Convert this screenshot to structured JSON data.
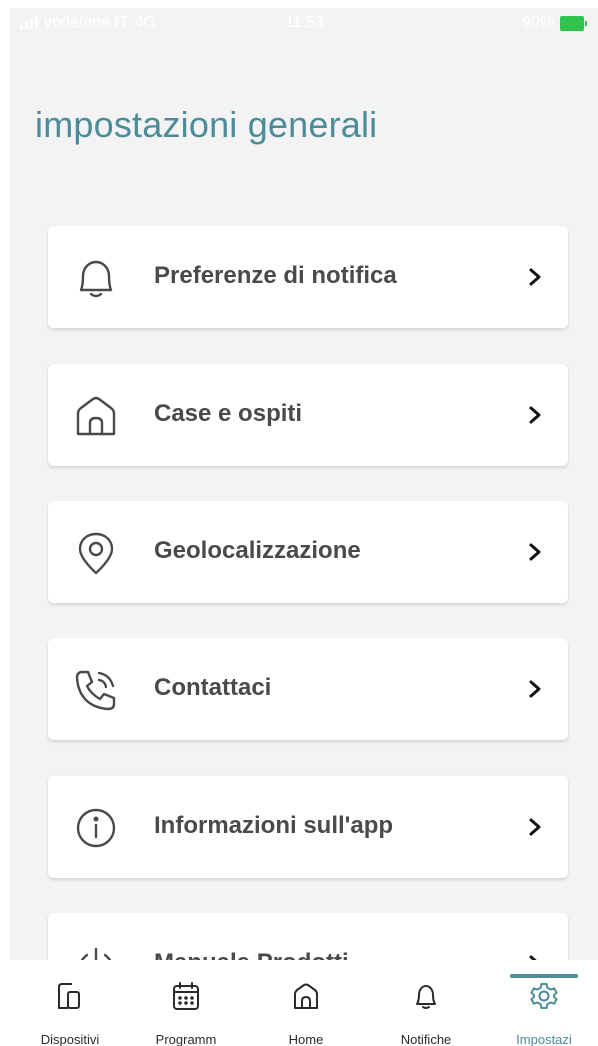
{
  "status_bar": {
    "carrier": "vodafone IT",
    "network": "4G",
    "time": "11:53",
    "battery": "90%",
    "battery_color": "#2fc44d"
  },
  "header": {
    "title": "impostazioni generali",
    "title_color": "#4a8c99"
  },
  "menu": {
    "items": [
      {
        "label": "Preferenze di notifica",
        "icon": "bell-icon"
      },
      {
        "label": "Case e ospiti",
        "icon": "house-icon"
      },
      {
        "label": "Geolocalizzazione",
        "icon": "location-pin-icon"
      },
      {
        "label": "Contattaci",
        "icon": "phone-call-icon"
      },
      {
        "label": "Informazioni sull'app",
        "icon": "info-icon"
      },
      {
        "label": "Manuale Prodotti",
        "icon": "power-icon"
      }
    ],
    "chevron_icon": "chevron-right-icon"
  },
  "tab_bar": {
    "tabs": [
      {
        "label": "Dispositivi",
        "icon": "devices-icon"
      },
      {
        "label": "Programm",
        "icon": "calendar-icon"
      },
      {
        "label": "Home",
        "icon": "house-icon"
      },
      {
        "label": "Notifiche",
        "icon": "bell-icon"
      },
      {
        "label": "Impostazi",
        "icon": "gear-icon",
        "active": true
      }
    ],
    "active_color": "#4a8c99"
  }
}
